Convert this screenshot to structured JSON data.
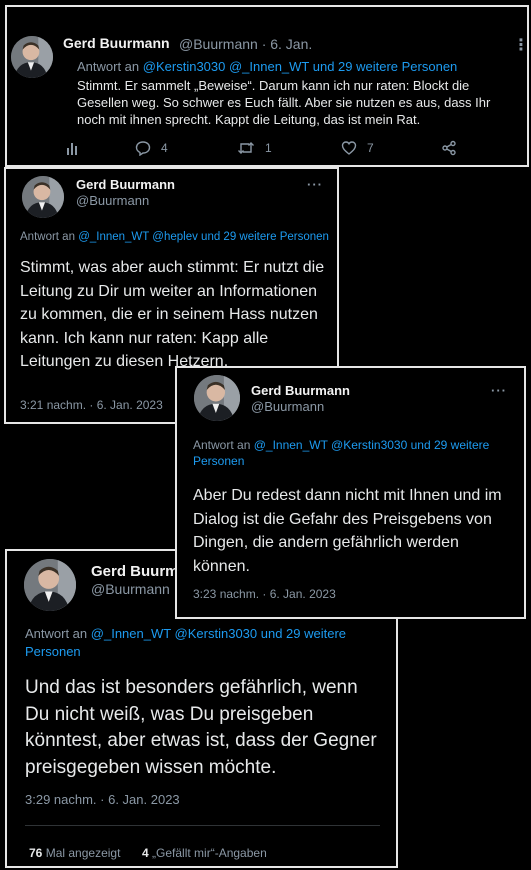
{
  "tweet1": {
    "name": "Gerd Buurmann",
    "handle_time": "@Buurmann · 6. Jan.",
    "reply_prefix": "Antwort an",
    "reply_links": "@Kerstin3030 @_Innen_WT und 29 weitere Personen",
    "text": "Stimmt. Er sammelt „Beweise“. Darum kann ich nur raten: Blockt die Gesellen weg. So schwer es Euch fällt. Aber sie nutzen es aus, dass Ihr noch mit ihnen sprecht. Kappt die Leitung, das ist mein Rat.",
    "actions": {
      "stats_icon": "stats-icon",
      "reply_count": "4",
      "retweet_count": "1",
      "like_count": "7",
      "share_icon": "share-icon"
    },
    "more": "⋮"
  },
  "tweet2": {
    "name": "Gerd Buurmann",
    "handle": "@Buurmann",
    "more": "···",
    "reply_prefix": "Antwort an",
    "reply_links": "@_Innen_WT @heplev und 29 weitere Personen",
    "text": "Stimmt, was aber auch stimmt: Er nutzt die Leitung zu Dir um weiter an Informationen zu kommen, die er in seinem Hass nutzen kann. Ich kann nur raten: Kapp alle Leitungen zu diesen Hetzern.",
    "timestamp": "3:21 nachm. · 6. Jan. 2023"
  },
  "tweet3": {
    "name": "Gerd Buurmann",
    "handle": "@Buurmann",
    "more": "···",
    "reply_prefix": "Antwort an",
    "reply_links": "@_Innen_WT @Kerstin3030 und 29 weitere Personen",
    "text": "Aber Du redest dann nicht mit Ihnen und im Dialog ist die Gefahr des Preisgebens von Dingen, die andern gefährlich werden können.",
    "timestamp": "3:23 nachm. · 6. Jan. 2023"
  },
  "tweet4": {
    "name": "Gerd Buurmann",
    "handle": "@Buurmann",
    "reply_prefix": "Antwort an",
    "reply_links": "@_Innen_WT @Kerstin3030 und 29 weitere Personen",
    "text": "Und das ist besonders gefährlich, wenn Du nicht weiß, was Du preisgeben könntest, aber etwas ist, dass der Gegner preisgegeben wissen möchte.",
    "timestamp": "3:29 nachm. · 6. Jan. 2023",
    "views_count": "76",
    "views_label": "Mal angezeigt",
    "likes_count": "4",
    "likes_label": "„Gefällt mir“-Angaben"
  },
  "colors": {
    "link": "#1d9bf0",
    "muted": "#8b98a5",
    "text": "#e7e9ea",
    "border": "#e6e6e6"
  }
}
